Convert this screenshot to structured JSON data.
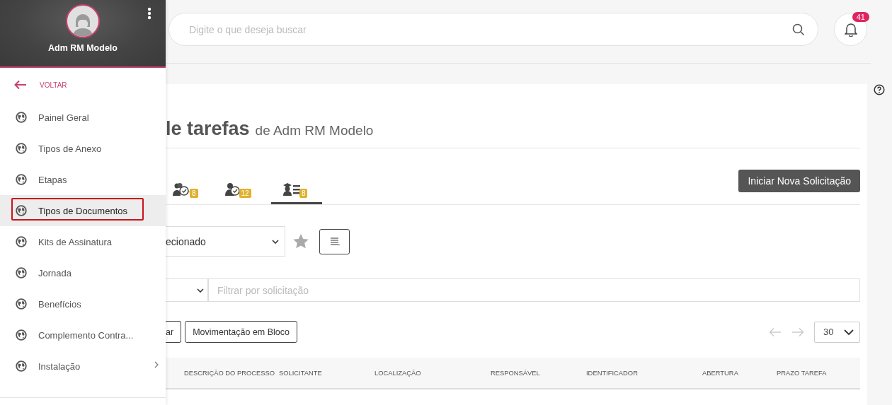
{
  "sidebar": {
    "user_name": "Adm RM Modelo",
    "back_label": "VOLTAR",
    "items": [
      {
        "label": "Painel Geral",
        "selected": false,
        "annotated": false,
        "has_children": false
      },
      {
        "label": "Tipos de Anexo",
        "selected": false,
        "annotated": false,
        "has_children": false
      },
      {
        "label": "Etapas",
        "selected": false,
        "annotated": false,
        "has_children": false
      },
      {
        "label": "Tipos de Documentos",
        "selected": true,
        "annotated": true,
        "has_children": false
      },
      {
        "label": "Kits de Assinatura",
        "selected": false,
        "annotated": false,
        "has_children": false
      },
      {
        "label": "Jornada",
        "selected": false,
        "annotated": false,
        "has_children": false
      },
      {
        "label": "Benefícios",
        "selected": false,
        "annotated": false,
        "has_children": false
      },
      {
        "label": "Complemento Contra...",
        "selected": false,
        "annotated": false,
        "has_children": false
      },
      {
        "label": "Instalação",
        "selected": false,
        "annotated": false,
        "has_children": true
      }
    ]
  },
  "search": {
    "placeholder": "Digite o que deseja buscar"
  },
  "notifications": {
    "count": "41"
  },
  "page": {
    "title": "le tarefas",
    "subtitle": "de Adm RM Modelo",
    "tabs": [
      {
        "kind": "team",
        "badge": "8",
        "selected": false
      },
      {
        "kind": "mine",
        "badge": "12",
        "selected": false
      },
      {
        "kind": "requests",
        "badge": "8",
        "selected": true
      }
    ],
    "new_button": "Iniciar Nova Solicitação",
    "view_select": {
      "value": "ecionado"
    },
    "filter": {
      "placeholder": "Filtrar por solicitação"
    },
    "buttons": [
      "ar",
      "Movimentação em Bloco"
    ],
    "page_size": "30",
    "table": {
      "columns": [
        "DESCRIÇÃO DO PROCESSO",
        "SOLICITANTE",
        "LOCALIZAÇÃO",
        "RESPONSÁVEL",
        "IDENTIFICADOR",
        "ABERTURA",
        "PRAZO TAREFA"
      ]
    }
  }
}
